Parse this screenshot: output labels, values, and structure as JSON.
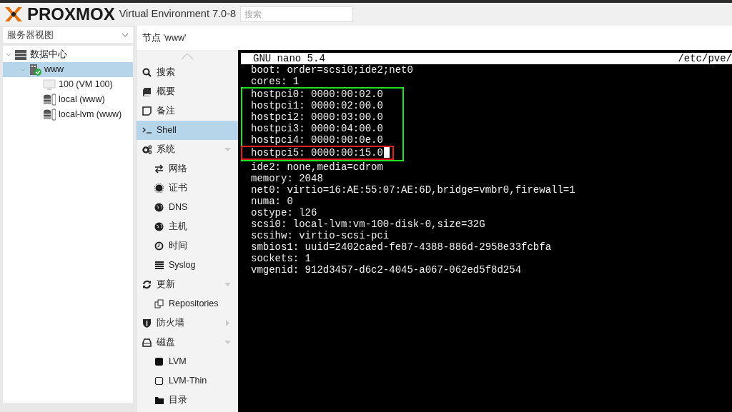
{
  "header": {
    "logo": "PROXMOX",
    "product": "Virtual Environment 7.0-8",
    "search": {
      "placeholder": "搜索"
    }
  },
  "view_selector": {
    "value": "服务器视图"
  },
  "tree": [
    {
      "label": "数据中心",
      "kind": "datacenter",
      "expanded": true,
      "selected": false,
      "children": [
        {
          "label": "www",
          "kind": "node",
          "expanded": true,
          "selected": true,
          "children": [
            {
              "label": "100 (VM 100)",
              "kind": "vm",
              "selected": false
            },
            {
              "label": "local (www)",
              "kind": "storage",
              "selected": false
            },
            {
              "label": "local-lvm (www)",
              "kind": "storage",
              "selected": false
            }
          ]
        }
      ]
    }
  ],
  "panel_title": "节点 'www'",
  "nav": [
    {
      "label": "搜索",
      "kind": "search",
      "selected": false
    },
    {
      "label": "概要",
      "kind": "book",
      "selected": false
    },
    {
      "label": "备注",
      "kind": "note",
      "selected": false
    },
    {
      "label": "Shell",
      "kind": "terminal",
      "selected": true
    },
    {
      "label": "系统",
      "kind": "gears",
      "selected": false,
      "expanded": true,
      "children": [
        {
          "label": "网络",
          "kind": "exchange",
          "selected": false
        },
        {
          "label": "证书",
          "kind": "cert",
          "selected": false
        },
        {
          "label": "DNS",
          "kind": "globe",
          "selected": false
        },
        {
          "label": "主机",
          "kind": "globe",
          "selected": false
        },
        {
          "label": "时间",
          "kind": "clock",
          "selected": false
        },
        {
          "label": "Syslog",
          "kind": "list",
          "selected": false
        }
      ]
    },
    {
      "label": "更新",
      "kind": "refresh",
      "selected": false,
      "expanded": true,
      "children": [
        {
          "label": "Repositories",
          "kind": "copy",
          "selected": false
        }
      ]
    },
    {
      "label": "防火墙",
      "kind": "shield",
      "selected": false,
      "expanded": false
    },
    {
      "label": "磁盘",
      "kind": "drive",
      "selected": false,
      "expanded": true,
      "children": [
        {
          "label": "LVM",
          "kind": "square-filled",
          "selected": false
        },
        {
          "label": "LVM-Thin",
          "kind": "square",
          "selected": false
        },
        {
          "label": "目录",
          "kind": "folder",
          "selected": false
        }
      ]
    }
  ],
  "terminal": {
    "title": "GNU nano 5.4",
    "file": "/etc/pve/",
    "lines": [
      {
        "kind": "line",
        "text": "boot: order=scsi0;ide2;net0"
      },
      {
        "kind": "line",
        "text": "cores: 1"
      },
      {
        "kind": "box",
        "color": "#22e022",
        "lines": [
          {
            "kind": "line",
            "text": "hostpci0: 0000:00:02.0"
          },
          {
            "kind": "line",
            "text": "hostpci1: 0000:02:00.0"
          },
          {
            "kind": "line",
            "text": "hostpci2: 0000:03:00.0"
          },
          {
            "kind": "line",
            "text": "hostpci3: 0000:04:00.0"
          },
          {
            "kind": "line",
            "text": "hostpci4: 0000:00:0e.0"
          },
          {
            "kind": "box",
            "color": "#e02020",
            "lines": [
              {
                "kind": "line",
                "text": "hostpci5: 0000:00:15.0",
                "cursor": true
              }
            ]
          }
        ]
      },
      {
        "kind": "line",
        "text": "ide2: none,media=cdrom"
      },
      {
        "kind": "line",
        "text": "memory: 2048"
      },
      {
        "kind": "line",
        "text": "net0: virtio=16:AE:55:07:AE:6D,bridge=vmbr0,firewall=1"
      },
      {
        "kind": "line",
        "text": "numa: 0"
      },
      {
        "kind": "line",
        "text": "ostype: l26"
      },
      {
        "kind": "line",
        "text": "scsi0: local-lvm:vm-100-disk-0,size=32G"
      },
      {
        "kind": "line",
        "text": "scsihw: virtio-scsi-pci"
      },
      {
        "kind": "line",
        "text": "smbios1: uuid=2402caed-fe87-4388-886d-2958e33fcbfa"
      },
      {
        "kind": "line",
        "text": "sockets: 1"
      },
      {
        "kind": "line",
        "text": "vmgenid: 912d3457-d6c2-4045-a067-062ed5f8d254"
      }
    ]
  }
}
